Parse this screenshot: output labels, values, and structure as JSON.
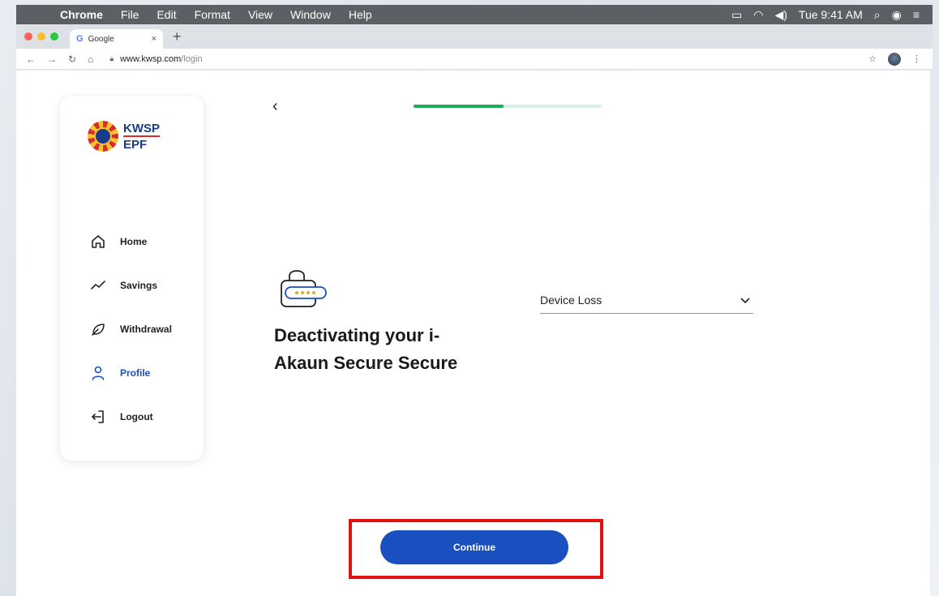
{
  "menubar": {
    "app_name": "Chrome",
    "items": [
      "File",
      "Edit",
      "Format",
      "View",
      "Window",
      "Help"
    ],
    "clock": "Tue 9:41 AM"
  },
  "browser": {
    "tab_title": "Google",
    "url_host": "www.kwsp.com",
    "url_path": "/login"
  },
  "logo": {
    "line1": "KWSP",
    "line2": "EPF"
  },
  "sidebar": {
    "items": [
      {
        "label": "Home",
        "icon": "home-icon"
      },
      {
        "label": "Savings",
        "icon": "trend-icon"
      },
      {
        "label": "Withdrawal",
        "icon": "leaf-icon"
      },
      {
        "label": "Profile",
        "icon": "user-icon"
      },
      {
        "label": "Logout",
        "icon": "logout-icon"
      }
    ],
    "active": "Profile"
  },
  "progress": {
    "fraction": 0.48
  },
  "main": {
    "headline": "Deactivating your i-Akaun Secure Secure",
    "reason_select": "Device Loss",
    "continue_label": "Continue"
  },
  "colors": {
    "primary": "#1a4fbf",
    "progress_fill": "#1eaa5c",
    "progress_track": "#d8f0e6",
    "highlight_outline": "#e0110f",
    "lock_accent": "#e0a82e"
  }
}
